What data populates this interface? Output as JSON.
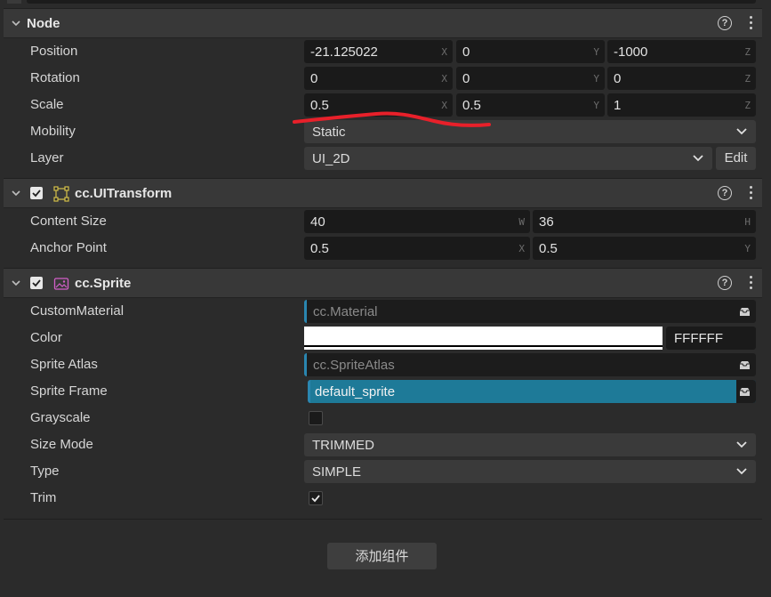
{
  "node": {
    "title": "Node",
    "position": {
      "label": "Position",
      "x": "-21.125022",
      "y": "0",
      "z": "-1000"
    },
    "rotation": {
      "label": "Rotation",
      "x": "0",
      "y": "0",
      "z": "0"
    },
    "scale": {
      "label": "Scale",
      "x": "0.5",
      "y": "0.5",
      "z": "1"
    },
    "mobility": {
      "label": "Mobility",
      "value": "Static"
    },
    "layer": {
      "label": "Layer",
      "value": "UI_2D",
      "edit_label": "Edit"
    },
    "axes": {
      "x": "X",
      "y": "Y",
      "z": "Z",
      "w": "W",
      "h": "H"
    }
  },
  "uitransform": {
    "title": "cc.UITransform",
    "content_size": {
      "label": "Content Size",
      "w": "40",
      "h": "36"
    },
    "anchor_point": {
      "label": "Anchor Point",
      "x": "0.5",
      "y": "0.5"
    }
  },
  "sprite": {
    "title": "cc.Sprite",
    "custom_material": {
      "label": "CustomMaterial",
      "placeholder": "cc.Material"
    },
    "color": {
      "label": "Color",
      "hex": "FFFFFF",
      "swatch": "#ffffff"
    },
    "sprite_atlas": {
      "label": "Sprite Atlas",
      "placeholder": "cc.SpriteAtlas"
    },
    "sprite_frame": {
      "label": "Sprite Frame",
      "value": "default_sprite"
    },
    "grayscale": {
      "label": "Grayscale",
      "checked": false
    },
    "size_mode": {
      "label": "Size Mode",
      "value": "TRIMMED"
    },
    "type": {
      "label": "Type",
      "value": "SIMPLE"
    },
    "trim": {
      "label": "Trim",
      "checked": true
    }
  },
  "help_glyph": "?",
  "add_component_label": "添加组件",
  "colors": {
    "accent": "#2a86b0",
    "sprite_frame_bg": "#1e7a98",
    "annotation": "#e8202a"
  }
}
